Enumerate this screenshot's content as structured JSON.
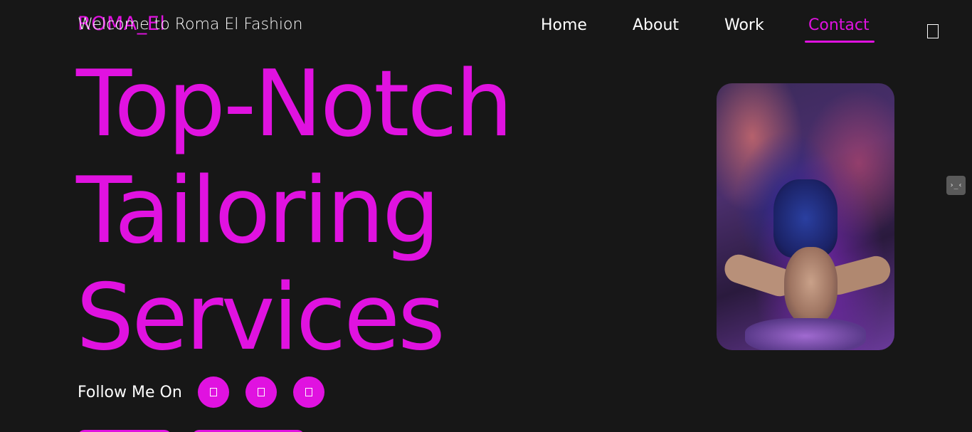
{
  "header": {
    "logo_text": "ROMA_El",
    "welcome_text": "Welcome to Roma El Fashion",
    "nav": {
      "items": [
        {
          "label": "Home",
          "active": false
        },
        {
          "label": "About",
          "active": false
        },
        {
          "label": "Work",
          "active": false
        },
        {
          "label": "Contact",
          "active": true
        }
      ]
    },
    "menu_icon": "menu-icon"
  },
  "hero": {
    "title_lines": [
      "Top-Notch",
      "Tailoring",
      "Services"
    ],
    "image_icon": "fashion-photo",
    "follow_label": "Follow Me On",
    "social_icons": [
      "social-icon-1",
      "social-icon-2",
      "social-icon-3"
    ]
  },
  "side_widget": {
    "label": "›_‹"
  },
  "colors": {
    "background": "#171717",
    "accent": "#e012e0",
    "text": "#ffffff"
  }
}
